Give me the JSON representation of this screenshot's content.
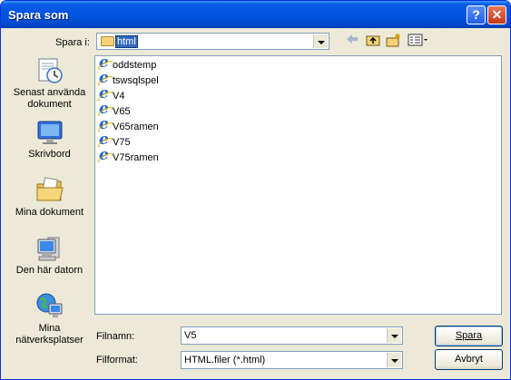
{
  "window": {
    "title": "Spara som"
  },
  "titlebar": {
    "help": "?",
    "close": "✕"
  },
  "lookin": {
    "label": "Spara i:",
    "value": "html"
  },
  "places": [
    {
      "label": "Senast använda dokument",
      "icon": "recent-documents-icon"
    },
    {
      "label": "Skrivbord",
      "icon": "desktop-icon"
    },
    {
      "label": "Mina dokument",
      "icon": "my-documents-icon"
    },
    {
      "label": "Den här datorn",
      "icon": "my-computer-icon"
    },
    {
      "label": "Mina nätverksplatser",
      "icon": "network-places-icon"
    }
  ],
  "files": [
    "oddstemp",
    "tswsqlspel",
    "V4",
    "V65",
    "V65ramen",
    "V75",
    "V75ramen"
  ],
  "filename": {
    "label": "Filnamn:",
    "value": "V5"
  },
  "filetype": {
    "label": "Filformat:",
    "value": "HTML.filer (*.html)"
  },
  "buttons": {
    "save": "Spara",
    "cancel": "Avbryt"
  },
  "colors": {
    "title_blue": "#0054e3",
    "selection": "#316ac5",
    "dialog_bg": "#ece9d8"
  }
}
